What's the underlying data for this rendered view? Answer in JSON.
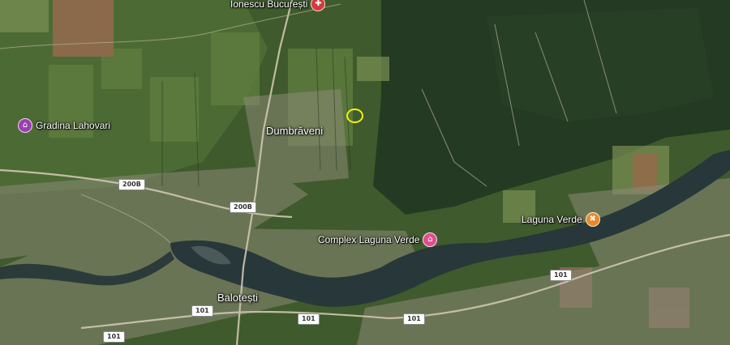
{
  "map": {
    "type": "satellite",
    "colors": {
      "field": "#4d6a33",
      "forest": "#233820",
      "lake": "#26363a",
      "road": "#cfc7b0",
      "marker": "#f2f20a",
      "pin_purple": "#9a3fb3",
      "pin_pink": "#e04e8e",
      "pin_orange": "#e8892a",
      "pin_red": "#d33a3a"
    }
  },
  "places": {
    "dumbraveni": "Dumbrăveni",
    "balotesti": "Balotești"
  },
  "pois": {
    "gradina": {
      "label": "Gradina Lahovari",
      "icon": "⌂",
      "icon_name": "garden-icon"
    },
    "complex": {
      "label": "Complex Laguna Verde",
      "icon": "⌂",
      "icon_name": "hotel-icon"
    },
    "laguna": {
      "label": "Laguna Verde",
      "icon": "✖",
      "icon_name": "restaurant-icon"
    },
    "ionescu": {
      "label": "Ionescu București",
      "icon": "✚",
      "icon_name": "hospital-icon"
    }
  },
  "roads": {
    "r200b_a": "200B",
    "r200b_b": "200B",
    "r101_a": "101",
    "r101_b": "101",
    "r101_c": "101",
    "r101_d": "101"
  }
}
